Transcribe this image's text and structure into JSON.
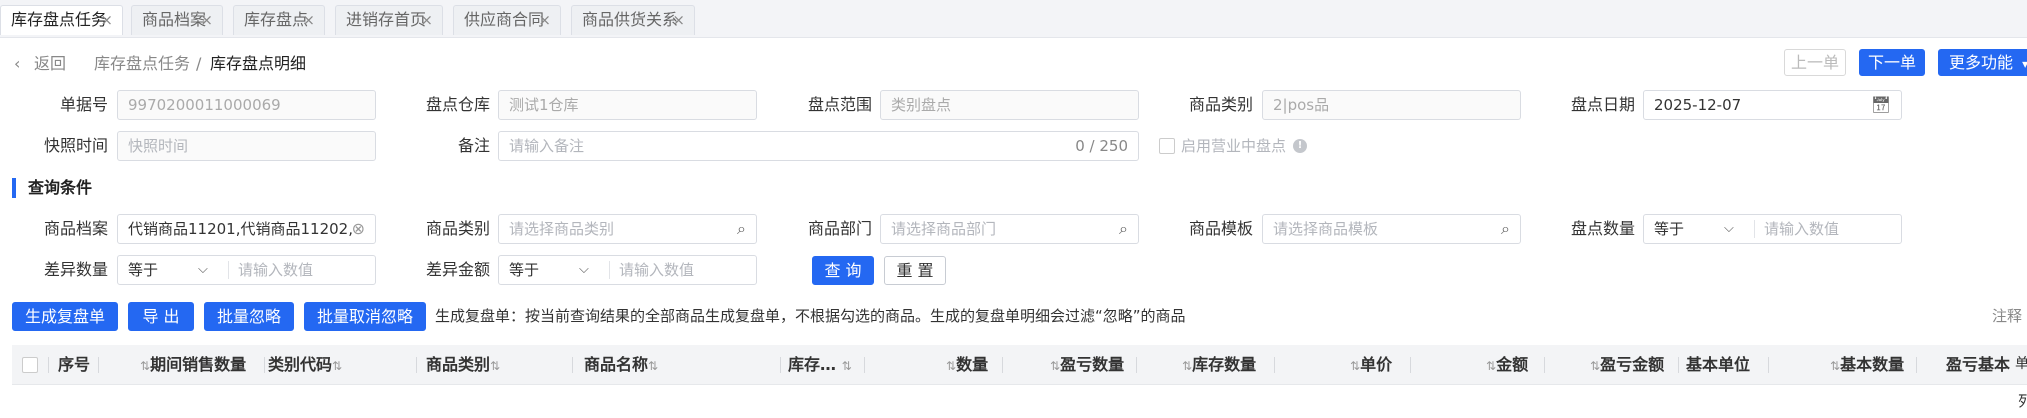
{
  "tabs": [
    {
      "label": "库存盘点任务",
      "active": true
    },
    {
      "label": "商品档案",
      "active": false
    },
    {
      "label": "库存盘点",
      "active": false
    },
    {
      "label": "进销存首页",
      "active": false
    },
    {
      "label": "供应商合同",
      "active": false
    },
    {
      "label": "商品供货关系",
      "active": false
    }
  ],
  "tab_close": "×",
  "breadcrumb": {
    "back": "返回",
    "parent": "库存盘点任务",
    "separator": "/",
    "current": "库存盘点明细"
  },
  "header_actions": {
    "prev": "上一单",
    "next": "下一单",
    "more": "更多功能"
  },
  "form": {
    "doc_no_label": "单据号",
    "doc_no_value": "9970200011000069",
    "warehouse_label": "盘点仓库",
    "warehouse_value": "测试1仓库",
    "scope_label": "盘点范围",
    "scope_value": "类别盘点",
    "category_label": "商品类别",
    "category_value": "2|pos品",
    "date_label": "盘点日期",
    "date_value": "2025-12-07",
    "snapshot_label": "快照时间",
    "snapshot_placeholder": "快照时间",
    "remark_label": "备注",
    "remark_placeholder": "请输入备注",
    "remark_count": "0 / 250",
    "business_check_label": "启用营业中盘点"
  },
  "query": {
    "title": "查询条件",
    "product_label": "商品档案",
    "product_value": "代销商品11201,代销商品11202,",
    "category_label": "商品类别",
    "category_placeholder": "请选择商品类别",
    "dept_label": "商品部门",
    "dept_placeholder": "请选择商品部门",
    "template_label": "商品模板",
    "template_placeholder": "请选择商品模板",
    "qty_label": "盘点数量",
    "qty_op": "等于",
    "qty_placeholder": "请输入数值",
    "diff_qty_label": "差异数量",
    "diff_qty_op": "等于",
    "diff_qty_placeholder": "请输入数值",
    "diff_amt_label": "差异金额",
    "diff_amt_op": "等于",
    "diff_amt_placeholder": "请输入数值",
    "search_btn": "查 询",
    "reset_btn": "重 置"
  },
  "toolbar": {
    "generate": "生成复盘单",
    "export": "导 出",
    "batch_ignore": "批量忽略",
    "batch_unignore": "批量取消忽略",
    "hint": "生成复盘单：按当前查询结果的全部商品生成复盘单，不根据勾选的商品。生成的复盘单明细会过滤“忽略”的商品",
    "note": "注释"
  },
  "columns": [
    "序号",
    "期间销售数量",
    "类别代码",
    "商品类别",
    "商品名称",
    "库存…",
    "数量",
    "盈亏数量",
    "库存数量",
    "单价",
    "金额",
    "盈亏金额",
    "基本单位",
    "基本数量",
    "盈亏基本"
  ],
  "side_fragments": [
    "列",
    "单"
  ],
  "colors": {
    "primary": "#2468f2",
    "header_bg": "#f3f4f6",
    "tab_bg": "#eef0f3"
  },
  "icons": {
    "back": "chevron-left-icon",
    "calendar": "calendar-icon",
    "search": "search-icon",
    "clear": "clear-circle-icon",
    "info": "info-icon",
    "dropdown": "chevron-down-icon",
    "sort": "sort-icon"
  }
}
